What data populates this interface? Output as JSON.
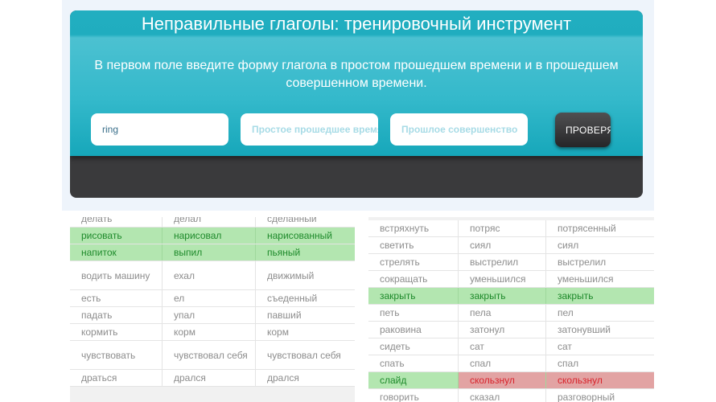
{
  "header": {
    "title": "Неправильные глаголы: тренировочный инструмент",
    "description": "В первом поле введите форму глагола в простом прошедшем времени и в прошедшем совершенном времени."
  },
  "form": {
    "verb_value": "ring",
    "past_simple_placeholder": "Простое прошедшее время",
    "past_perfect_placeholder": "Прошлое совершенство",
    "check_button": "ПРОВЕРЯТЬ"
  },
  "colors": {
    "header_teal": "#22aec0",
    "correct_green": "#b3e6b0",
    "wrong_red": "#e2a3a3"
  },
  "left_table": {
    "rows": [
      {
        "c": [
          "делать",
          "делал",
          "сделанный"
        ],
        "s": [
          "",
          "",
          ""
        ]
      },
      {
        "c": [
          "рисовать",
          "нарисовал",
          "нарисованный"
        ],
        "s": [
          "ok",
          "ok",
          "ok"
        ]
      },
      {
        "c": [
          "напиток",
          "выпил",
          "пьяный"
        ],
        "s": [
          "ok",
          "ok",
          "ok"
        ]
      },
      {
        "c": [
          "водить машину",
          "ехал",
          "движимый"
        ],
        "s": [
          "",
          "",
          ""
        ]
      },
      {
        "c": [
          "есть",
          "ел",
          "съеденный"
        ],
        "s": [
          "",
          "",
          ""
        ]
      },
      {
        "c": [
          "падать",
          "упал",
          "павший"
        ],
        "s": [
          "",
          "",
          ""
        ]
      },
      {
        "c": [
          "кормить",
          "корм",
          "корм"
        ],
        "s": [
          "",
          "",
          ""
        ]
      },
      {
        "c": [
          "чувствовать",
          "чувствовал себя",
          "чувствовал себя"
        ],
        "s": [
          "",
          "",
          ""
        ]
      },
      {
        "c": [
          "драться",
          "дрался",
          "дрался"
        ],
        "s": [
          "",
          "",
          ""
        ]
      }
    ]
  },
  "right_table": {
    "rows": [
      {
        "c": [
          "встряхнуть",
          "потряс",
          "потрясенный"
        ],
        "s": [
          "",
          "",
          ""
        ]
      },
      {
        "c": [
          "светить",
          "сиял",
          "сиял"
        ],
        "s": [
          "",
          "",
          ""
        ]
      },
      {
        "c": [
          "стрелять",
          "выстрелил",
          "выстрелил"
        ],
        "s": [
          "",
          "",
          ""
        ]
      },
      {
        "c": [
          "сокращать",
          "уменьшился",
          "уменьшился"
        ],
        "s": [
          "",
          "",
          ""
        ]
      },
      {
        "c": [
          "закрыть",
          "закрыть",
          "закрыть"
        ],
        "s": [
          "ok",
          "ok",
          "ok"
        ]
      },
      {
        "c": [
          "петь",
          "пела",
          "пел"
        ],
        "s": [
          "",
          "",
          ""
        ]
      },
      {
        "c": [
          "раковина",
          "затонул",
          "затонувший"
        ],
        "s": [
          "",
          "",
          ""
        ]
      },
      {
        "c": [
          "сидеть",
          "сат",
          "сат"
        ],
        "s": [
          "",
          "",
          ""
        ]
      },
      {
        "c": [
          "спать",
          "спал",
          "спал"
        ],
        "s": [
          "",
          "",
          ""
        ]
      },
      {
        "c": [
          "слайд",
          "скользнул",
          "скользнул"
        ],
        "s": [
          "ok",
          "bad",
          "bad"
        ]
      },
      {
        "c": [
          "говорить",
          "сказал",
          "разговорный"
        ],
        "s": [
          "",
          "",
          ""
        ]
      }
    ]
  }
}
